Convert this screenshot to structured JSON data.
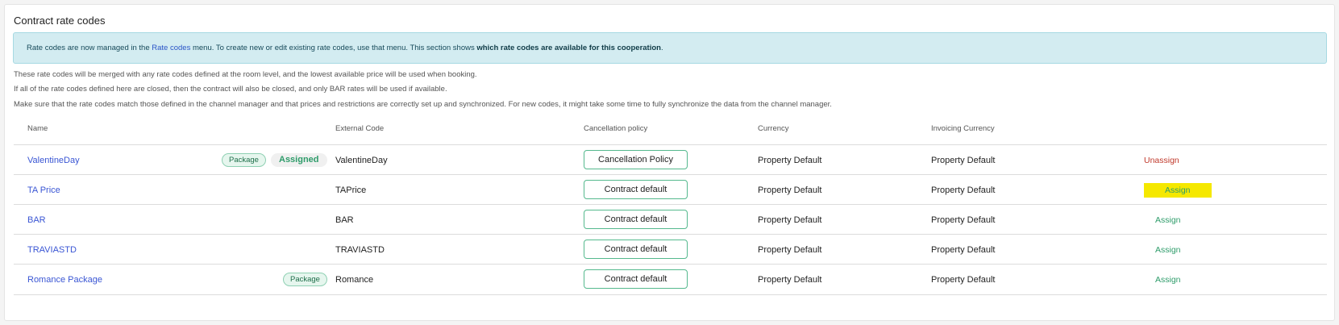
{
  "section_title": "Contract rate codes",
  "info": {
    "prefix": "Rate codes are now managed in the ",
    "link": "Rate codes",
    "middle": " menu. To create new or edit existing rate codes, use that menu. This section shows ",
    "bold": "which rate codes are available for this cooperation",
    "suffix": "."
  },
  "notes": [
    "These rate codes will be merged with any rate codes defined at the room level, and the lowest available price will be used when booking.",
    "If all of the rate codes defined here are closed, then the contract will also be closed, and only BAR rates will be used if available.",
    "Make sure that the rate codes match those defined in the channel manager and that prices and restrictions are correctly set up and synchronized. For new codes, it might take some time to fully synchronize the data from the channel manager."
  ],
  "table": {
    "headers": {
      "name": "Name",
      "external_code": "External Code",
      "cancellation_policy": "Cancellation policy",
      "currency": "Currency",
      "invoicing_currency": "Invoicing Currency"
    },
    "rows": [
      {
        "name": "ValentineDay",
        "package_badge": "Package",
        "assigned_badge": "Assigned",
        "external_code": "ValentineDay",
        "policy": "Cancellation Policy",
        "currency": "Property Default",
        "invoicing_currency": "Property Default",
        "action": "Unassign"
      },
      {
        "name": "TA Price",
        "package_badge": "",
        "assigned_badge": "",
        "external_code": "TAPrice",
        "policy": "Contract default",
        "currency": "Property Default",
        "invoicing_currency": "Property Default",
        "action": "Assign"
      },
      {
        "name": "BAR",
        "package_badge": "",
        "assigned_badge": "",
        "external_code": "BAR",
        "policy": "Contract default",
        "currency": "Property Default",
        "invoicing_currency": "Property Default",
        "action": "Assign"
      },
      {
        "name": "TRAVIASTD",
        "package_badge": "",
        "assigned_badge": "",
        "external_code": "TRAVIASTD",
        "policy": "Contract default",
        "currency": "Property Default",
        "invoicing_currency": "Property Default",
        "action": "Assign"
      },
      {
        "name": "Romance Package",
        "package_badge": "Package",
        "assigned_badge": "",
        "external_code": "Romance",
        "policy": "Contract default",
        "currency": "Property Default",
        "invoicing_currency": "Property Default",
        "action": "Assign"
      }
    ]
  },
  "colors": {
    "link": "#3a56d4",
    "assign": "#2e9c6a",
    "unassign": "#c0392b",
    "highlight": "#f5e800",
    "info_bg": "#d3ecf1"
  }
}
